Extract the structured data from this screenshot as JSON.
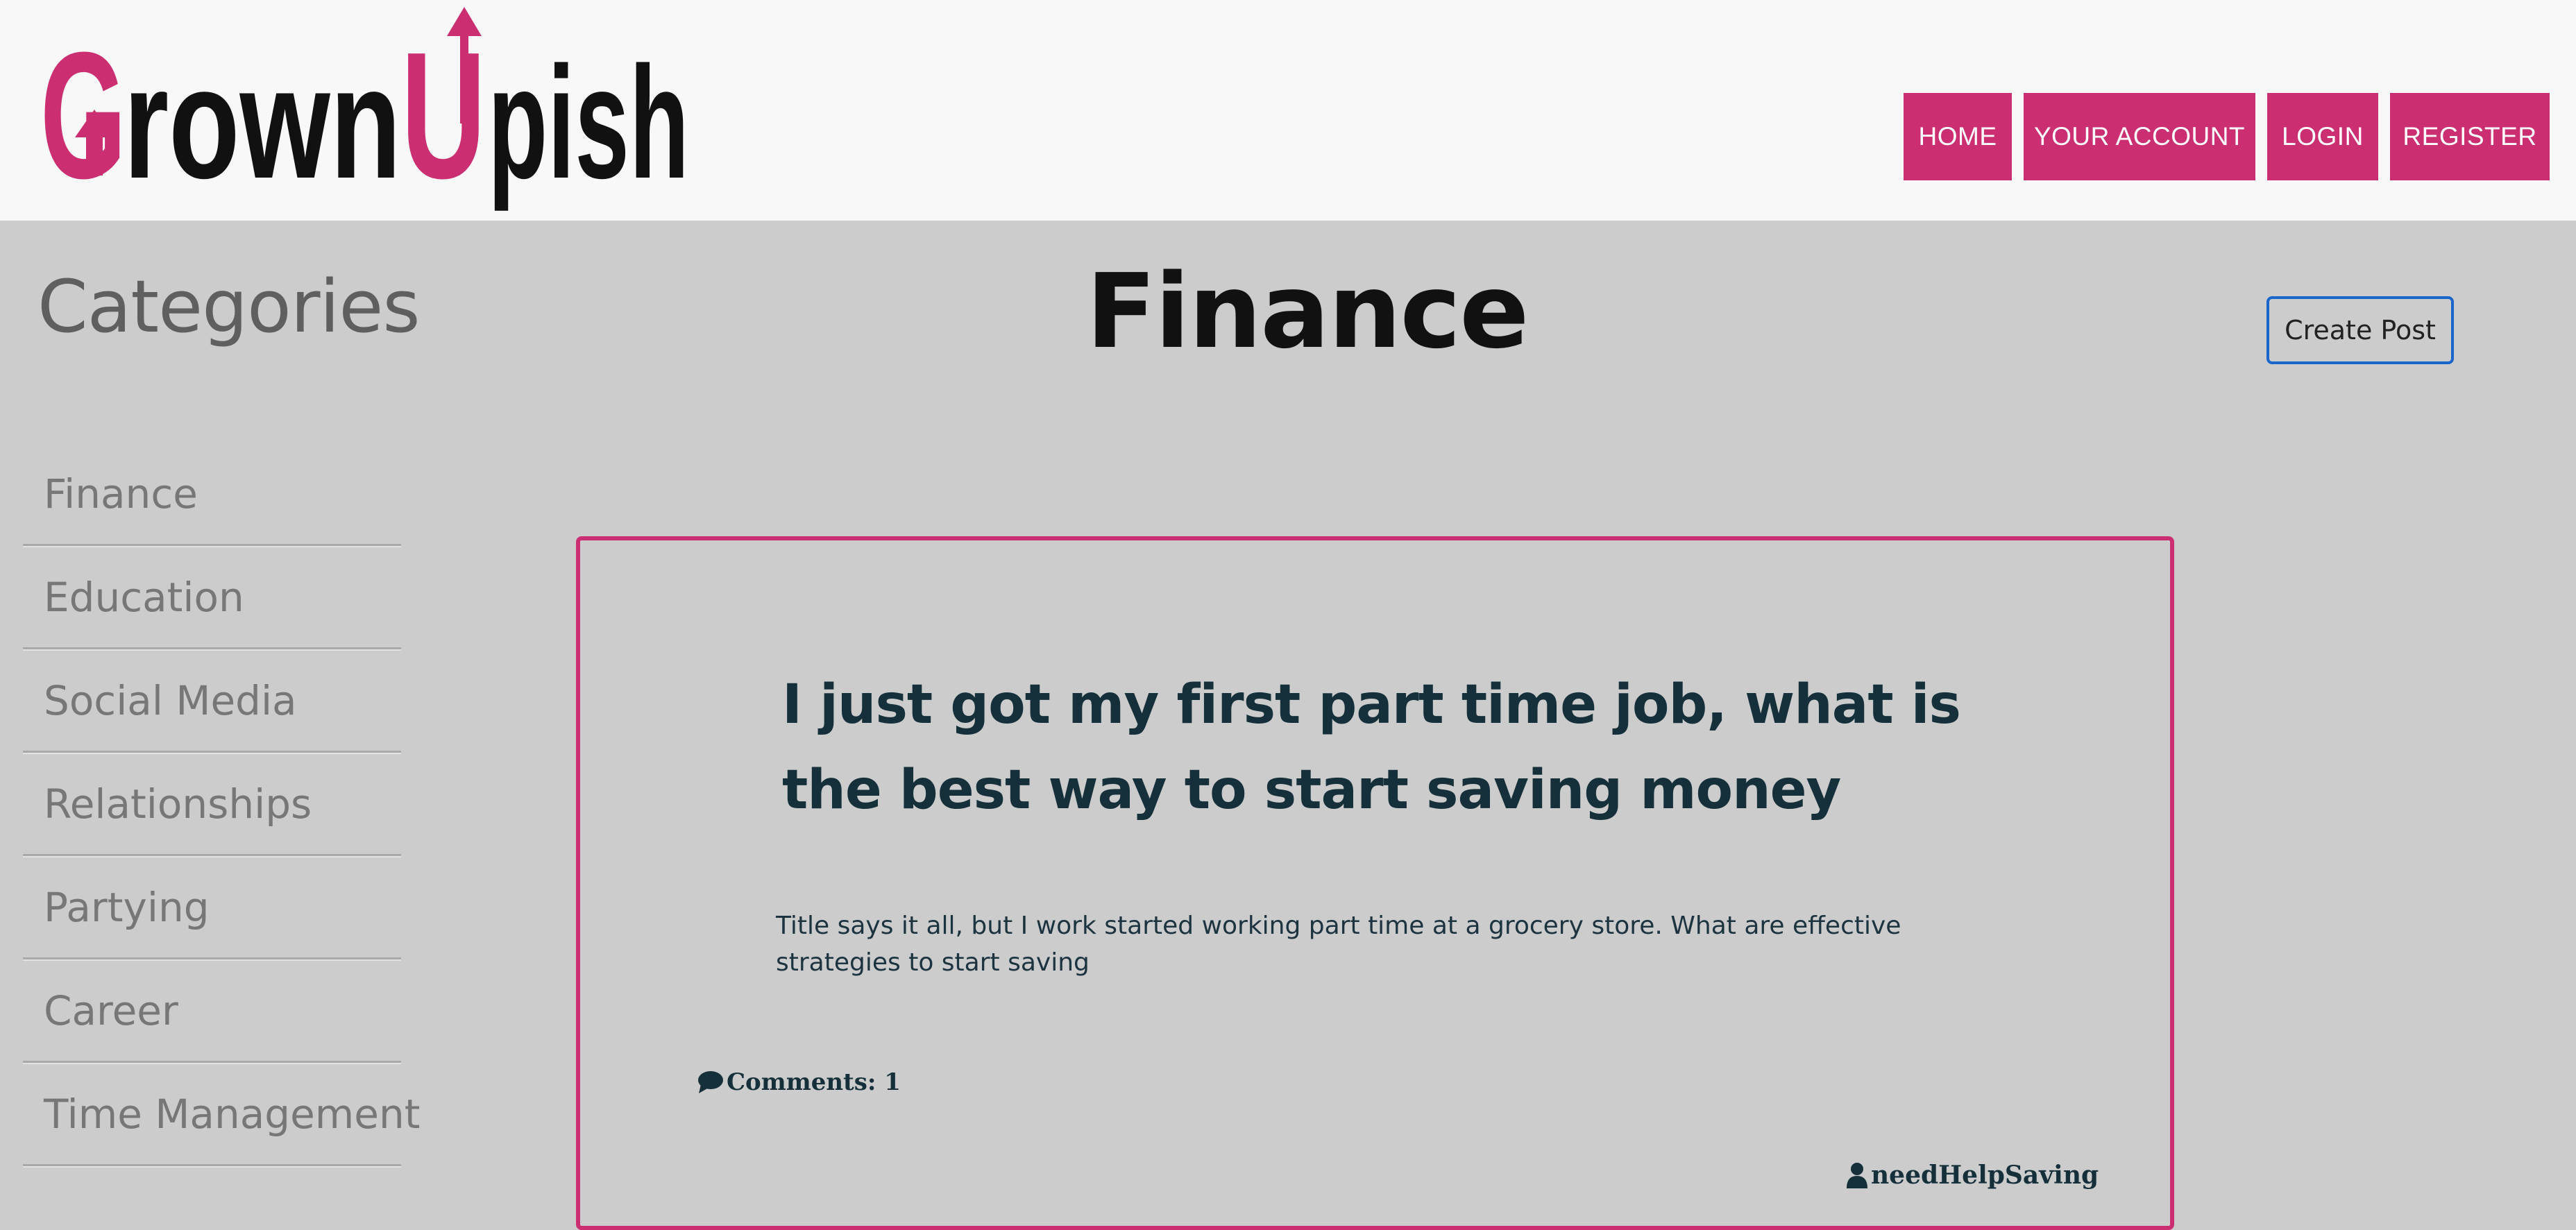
{
  "brand": {
    "logo_text": "GrownUpish",
    "accent_color": "#cc2e72",
    "logo_dark_color": "#111111"
  },
  "nav": {
    "home": "HOME",
    "your_account": "YOUR ACCOUNT",
    "login": "LOGIN",
    "register": "REGISTER"
  },
  "sidebar": {
    "title": "Categories",
    "items": [
      {
        "label": "Finance"
      },
      {
        "label": "Education"
      },
      {
        "label": "Social Media"
      },
      {
        "label": "Relationships"
      },
      {
        "label": "Partying"
      },
      {
        "label": "Career"
      },
      {
        "label": "Time Management"
      }
    ]
  },
  "main": {
    "page_title": "Finance",
    "create_post_label": "Create Post",
    "create_post_border_color": "#1a66cc"
  },
  "post": {
    "title": "I just got my first part time job, what is the best way to start saving money",
    "body": "Title says it all, but I work started working part time at a grocery store. What are effective strategies to start saving",
    "comments_text": "Comments: 1",
    "comments_icon": "comment-icon",
    "author": "needHelpSaving",
    "author_icon": "user-icon"
  }
}
